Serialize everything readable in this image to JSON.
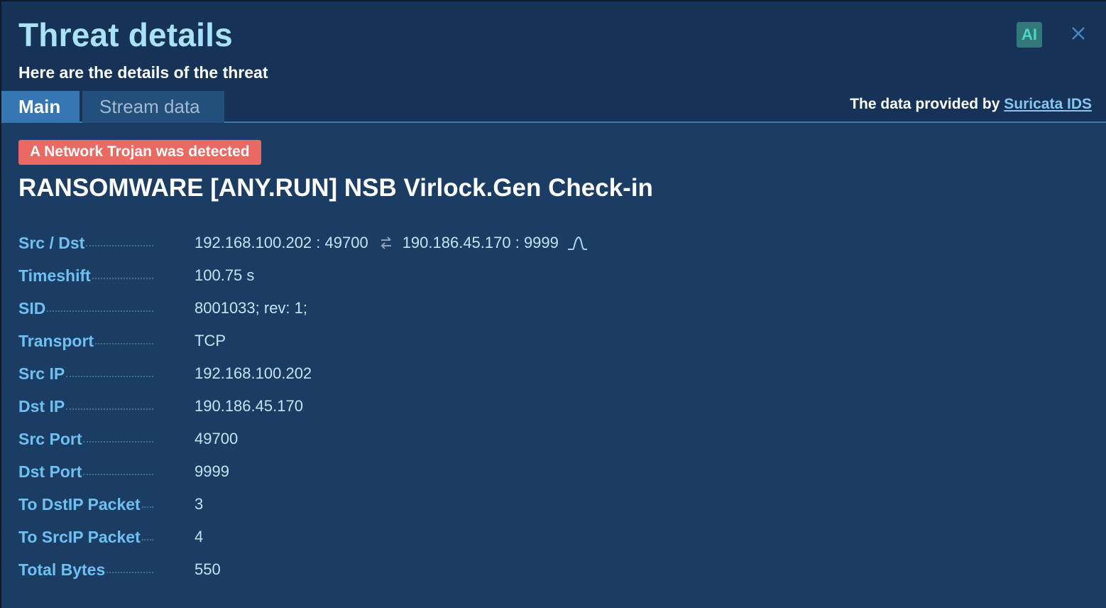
{
  "header": {
    "title": "Threat details",
    "subtitle": "Here are the details of the threat",
    "ai_label": "AI",
    "provided_prefix": "The data provided by",
    "provided_link": "Suricata IDS"
  },
  "tabs": [
    {
      "label": "Main",
      "active": true
    },
    {
      "label": "Stream data",
      "active": false
    }
  ],
  "alert": {
    "category": "A Network Trojan was detected",
    "name": "RANSOMWARE [ANY.RUN] NSB Virlock.Gen Check-in"
  },
  "connection": {
    "src": "192.168.100.202 : 49700",
    "dst": "190.186.45.170 : 9999"
  },
  "details": [
    {
      "label": "Src / Dst",
      "value": ""
    },
    {
      "label": "Timeshift",
      "value": "100.75 s"
    },
    {
      "label": "SID",
      "value": "8001033; rev: 1;"
    },
    {
      "label": "Transport",
      "value": "TCP"
    },
    {
      "label": "Src IP",
      "value": "192.168.100.202"
    },
    {
      "label": "Dst IP",
      "value": "190.186.45.170"
    },
    {
      "label": "Src Port",
      "value": "49700"
    },
    {
      "label": "Dst Port",
      "value": "9999"
    },
    {
      "label": "To DstIP Packet",
      "value": "3"
    },
    {
      "label": "To SrcIP Packet",
      "value": "4"
    },
    {
      "label": "Total Bytes",
      "value": "550"
    }
  ],
  "colors": {
    "title": "#a9e2f7",
    "alert_badge": "#ea6a63",
    "label": "#6fc0f2",
    "active_tab": "#3576b3",
    "ai_badge": "#327779"
  }
}
